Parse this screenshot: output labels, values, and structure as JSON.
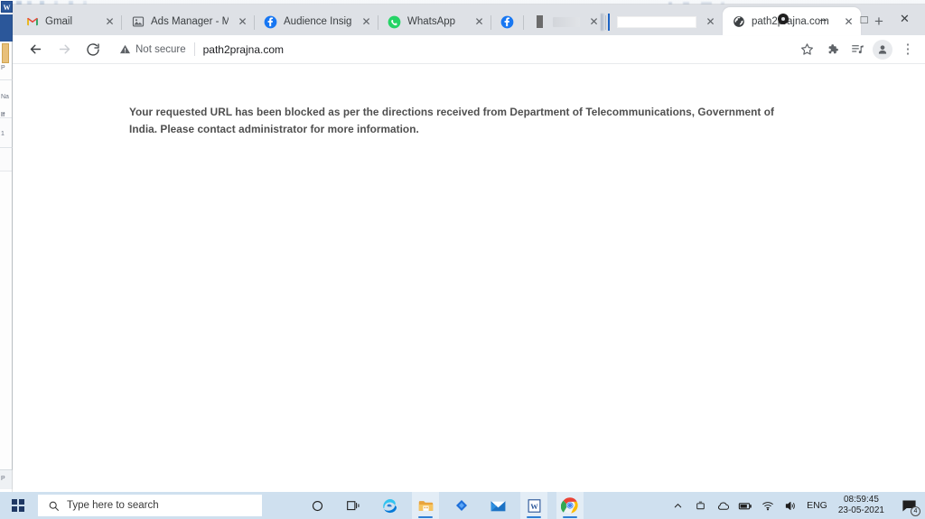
{
  "browser": {
    "tabs": [
      {
        "title": "Gmail",
        "favicon": "gmail-icon",
        "active": false,
        "style": "text"
      },
      {
        "title": "Ads Manager - M",
        "favicon": "ads-manager-icon",
        "active": false,
        "style": "text"
      },
      {
        "title": "Audience Insight",
        "favicon": "facebook-icon",
        "active": false,
        "style": "text"
      },
      {
        "title": "WhatsApp",
        "favicon": "whatsapp-icon",
        "active": false,
        "style": "text"
      },
      {
        "title": "",
        "favicon": "facebook-icon",
        "active": false,
        "style": "blurred"
      },
      {
        "title": "",
        "favicon": "blank-icon",
        "active": false,
        "style": "blurred"
      },
      {
        "title": "",
        "favicon": "none",
        "active": false,
        "style": "blank"
      },
      {
        "title": "path2prajna.com",
        "favicon": "globe-icon",
        "active": true,
        "style": "text"
      }
    ],
    "new_tab_label": "+",
    "tab_close_label": "✕",
    "window_controls": {
      "profile_label": "●",
      "minimize_label": "–",
      "maximize_label": "□",
      "close_label": "✕"
    },
    "toolbar": {
      "back_label": "←",
      "forward_label": "→",
      "reload_label": "↻",
      "security_text": "Not secure",
      "url": "path2prajna.com",
      "bookmark_label": "☆",
      "extensions_label": "extensions-icon",
      "reading_list_label": "reading-list-icon",
      "profile_label": "profile-icon",
      "menu_label": "⋮"
    }
  },
  "page": {
    "blocked_message": "Your requested URL has been blocked as per the directions received from Department of Telecommunications, Government of India. Please contact administrator for more information."
  },
  "taskbar": {
    "search_placeholder": "Type here to search",
    "apps": [
      {
        "name": "cortana",
        "active": false
      },
      {
        "name": "task-view",
        "active": false
      },
      {
        "name": "microsoft-edge",
        "active": false
      },
      {
        "name": "file-explorer",
        "active": true
      },
      {
        "name": "blue-diamond-app",
        "active": false
      },
      {
        "name": "mail",
        "active": false
      },
      {
        "name": "microsoft-word",
        "active": true
      },
      {
        "name": "google-chrome",
        "active": true
      }
    ],
    "tray": {
      "show_hidden_label": "∧",
      "language": "ENG",
      "time": "08:59:45",
      "date": "23-05-2021",
      "notification_count": "4"
    }
  },
  "background_window": {
    "app_letter": "W",
    "fragments": [
      "Na",
      "If",
      "1",
      "P"
    ]
  },
  "colors": {
    "tabstrip_bg": "#dee1e6",
    "taskbar_bg": "#cfe0ef",
    "accent_blue": "#2f7fd4",
    "word_blue": "#2b579a",
    "message_text": "#4f4f4f"
  }
}
